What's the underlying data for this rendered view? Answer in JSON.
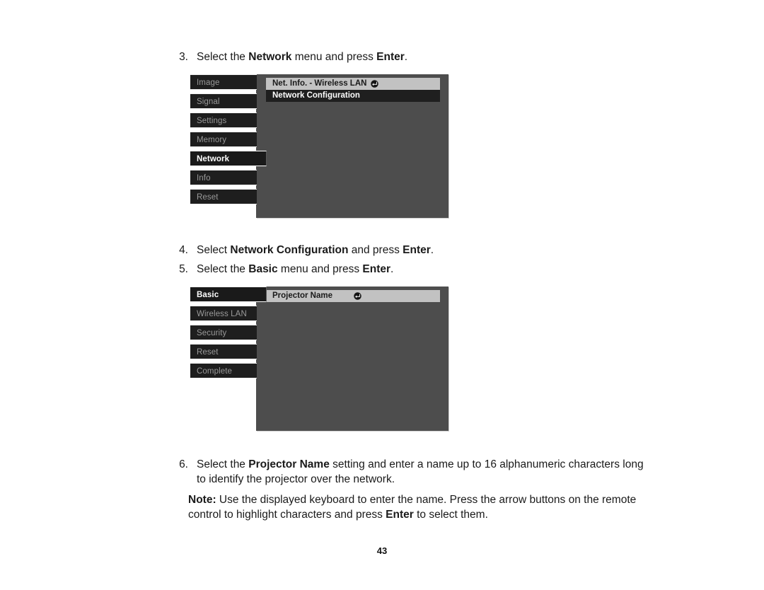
{
  "document": {
    "page_number": "43"
  },
  "steps": [
    {
      "number": "3.",
      "parts": [
        {
          "t": "Select the ",
          "b": false
        },
        {
          "t": "Network",
          "b": true
        },
        {
          "t": " menu and press ",
          "b": false
        },
        {
          "t": "Enter",
          "b": true
        },
        {
          "t": ".",
          "b": false
        }
      ]
    },
    {
      "number": "4.",
      "parts": [
        {
          "t": "Select ",
          "b": false
        },
        {
          "t": "Network Configuration",
          "b": true
        },
        {
          "t": " and press ",
          "b": false
        },
        {
          "t": "Enter",
          "b": true
        },
        {
          "t": ".",
          "b": false
        }
      ]
    },
    {
      "number": "5.",
      "parts": [
        {
          "t": "Select the ",
          "b": false
        },
        {
          "t": "Basic",
          "b": true
        },
        {
          "t": " menu and press ",
          "b": false
        },
        {
          "t": "Enter",
          "b": true
        },
        {
          "t": ".",
          "b": false
        }
      ]
    },
    {
      "number": "6.",
      "parts": [
        {
          "t": "Select the ",
          "b": false
        },
        {
          "t": "Projector Name",
          "b": true
        },
        {
          "t": " setting and enter a name up to 16 alphanumeric characters long to identify the projector over the network.",
          "b": false
        }
      ]
    }
  ],
  "note": {
    "parts": [
      {
        "t": "Note:",
        "b": true
      },
      {
        "t": " Use the displayed keyboard to enter the name. Press the arrow buttons on the remote control to highlight characters and press ",
        "b": false
      },
      {
        "t": "Enter",
        "b": true
      },
      {
        "t": " to select them.",
        "b": false
      }
    ]
  },
  "osd_main": {
    "tabs": [
      {
        "label": "Image",
        "selected": false
      },
      {
        "label": "Signal",
        "selected": false
      },
      {
        "label": "Settings",
        "selected": false
      },
      {
        "label": "Memory",
        "selected": false
      },
      {
        "label": "Network",
        "selected": true
      },
      {
        "label": "Info",
        "selected": false
      },
      {
        "label": "Reset",
        "selected": false
      }
    ],
    "items": [
      {
        "label": "Net. Info. - Wireless LAN",
        "style": "highlight",
        "icon": "enter-icon",
        "icon_spaced": false
      },
      {
        "label": "Network Configuration",
        "style": "plain",
        "icon": null,
        "icon_spaced": false
      }
    ]
  },
  "osd_network": {
    "tabs": [
      {
        "label": "Basic",
        "selected": true
      },
      {
        "label": "Wireless LAN",
        "selected": false
      },
      {
        "label": "Security",
        "selected": false
      },
      {
        "label": "Reset",
        "selected": false
      },
      {
        "label": "Complete",
        "selected": false
      }
    ],
    "items": [
      {
        "label": "Projector Name",
        "style": "highlight",
        "icon": "enter-icon",
        "icon_spaced": true
      }
    ]
  },
  "colors": {
    "panel_bg": "#4d4d4d",
    "tab_bg": "#1e1e1e",
    "tab_text": "#9a9a9a",
    "tab_selected_text": "#ffffff",
    "item_highlight_bg": "#c2c2c2",
    "item_plain_bg": "#1f1f1f",
    "page_bg": "#ffffff",
    "text": "#1a1a1a"
  }
}
